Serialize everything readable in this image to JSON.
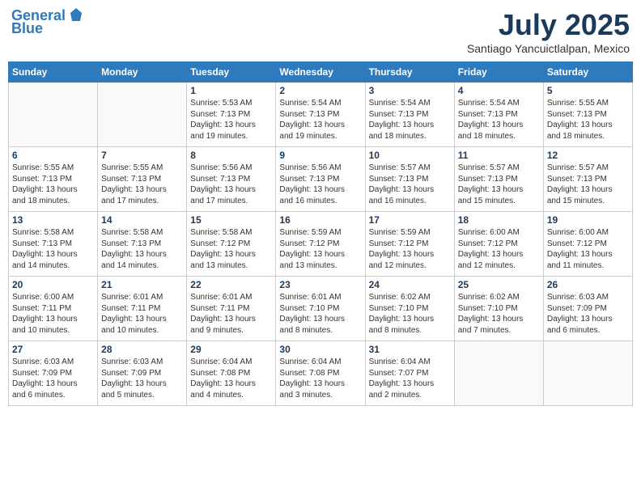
{
  "header": {
    "logo_line1": "General",
    "logo_line2": "Blue",
    "month": "July 2025",
    "location": "Santiago Yancuictlalpan, Mexico"
  },
  "days_of_week": [
    "Sunday",
    "Monday",
    "Tuesday",
    "Wednesday",
    "Thursday",
    "Friday",
    "Saturday"
  ],
  "weeks": [
    [
      {
        "day": "",
        "detail": ""
      },
      {
        "day": "",
        "detail": ""
      },
      {
        "day": "1",
        "detail": "Sunrise: 5:53 AM\nSunset: 7:13 PM\nDaylight: 13 hours\nand 19 minutes."
      },
      {
        "day": "2",
        "detail": "Sunrise: 5:54 AM\nSunset: 7:13 PM\nDaylight: 13 hours\nand 19 minutes."
      },
      {
        "day": "3",
        "detail": "Sunrise: 5:54 AM\nSunset: 7:13 PM\nDaylight: 13 hours\nand 18 minutes."
      },
      {
        "day": "4",
        "detail": "Sunrise: 5:54 AM\nSunset: 7:13 PM\nDaylight: 13 hours\nand 18 minutes."
      },
      {
        "day": "5",
        "detail": "Sunrise: 5:55 AM\nSunset: 7:13 PM\nDaylight: 13 hours\nand 18 minutes."
      }
    ],
    [
      {
        "day": "6",
        "detail": "Sunrise: 5:55 AM\nSunset: 7:13 PM\nDaylight: 13 hours\nand 18 minutes."
      },
      {
        "day": "7",
        "detail": "Sunrise: 5:55 AM\nSunset: 7:13 PM\nDaylight: 13 hours\nand 17 minutes."
      },
      {
        "day": "8",
        "detail": "Sunrise: 5:56 AM\nSunset: 7:13 PM\nDaylight: 13 hours\nand 17 minutes."
      },
      {
        "day": "9",
        "detail": "Sunrise: 5:56 AM\nSunset: 7:13 PM\nDaylight: 13 hours\nand 16 minutes."
      },
      {
        "day": "10",
        "detail": "Sunrise: 5:57 AM\nSunset: 7:13 PM\nDaylight: 13 hours\nand 16 minutes."
      },
      {
        "day": "11",
        "detail": "Sunrise: 5:57 AM\nSunset: 7:13 PM\nDaylight: 13 hours\nand 15 minutes."
      },
      {
        "day": "12",
        "detail": "Sunrise: 5:57 AM\nSunset: 7:13 PM\nDaylight: 13 hours\nand 15 minutes."
      }
    ],
    [
      {
        "day": "13",
        "detail": "Sunrise: 5:58 AM\nSunset: 7:13 PM\nDaylight: 13 hours\nand 14 minutes."
      },
      {
        "day": "14",
        "detail": "Sunrise: 5:58 AM\nSunset: 7:13 PM\nDaylight: 13 hours\nand 14 minutes."
      },
      {
        "day": "15",
        "detail": "Sunrise: 5:58 AM\nSunset: 7:12 PM\nDaylight: 13 hours\nand 13 minutes."
      },
      {
        "day": "16",
        "detail": "Sunrise: 5:59 AM\nSunset: 7:12 PM\nDaylight: 13 hours\nand 13 minutes."
      },
      {
        "day": "17",
        "detail": "Sunrise: 5:59 AM\nSunset: 7:12 PM\nDaylight: 13 hours\nand 12 minutes."
      },
      {
        "day": "18",
        "detail": "Sunrise: 6:00 AM\nSunset: 7:12 PM\nDaylight: 13 hours\nand 12 minutes."
      },
      {
        "day": "19",
        "detail": "Sunrise: 6:00 AM\nSunset: 7:12 PM\nDaylight: 13 hours\nand 11 minutes."
      }
    ],
    [
      {
        "day": "20",
        "detail": "Sunrise: 6:00 AM\nSunset: 7:11 PM\nDaylight: 13 hours\nand 10 minutes."
      },
      {
        "day": "21",
        "detail": "Sunrise: 6:01 AM\nSunset: 7:11 PM\nDaylight: 13 hours\nand 10 minutes."
      },
      {
        "day": "22",
        "detail": "Sunrise: 6:01 AM\nSunset: 7:11 PM\nDaylight: 13 hours\nand 9 minutes."
      },
      {
        "day": "23",
        "detail": "Sunrise: 6:01 AM\nSunset: 7:10 PM\nDaylight: 13 hours\nand 8 minutes."
      },
      {
        "day": "24",
        "detail": "Sunrise: 6:02 AM\nSunset: 7:10 PM\nDaylight: 13 hours\nand 8 minutes."
      },
      {
        "day": "25",
        "detail": "Sunrise: 6:02 AM\nSunset: 7:10 PM\nDaylight: 13 hours\nand 7 minutes."
      },
      {
        "day": "26",
        "detail": "Sunrise: 6:03 AM\nSunset: 7:09 PM\nDaylight: 13 hours\nand 6 minutes."
      }
    ],
    [
      {
        "day": "27",
        "detail": "Sunrise: 6:03 AM\nSunset: 7:09 PM\nDaylight: 13 hours\nand 6 minutes."
      },
      {
        "day": "28",
        "detail": "Sunrise: 6:03 AM\nSunset: 7:09 PM\nDaylight: 13 hours\nand 5 minutes."
      },
      {
        "day": "29",
        "detail": "Sunrise: 6:04 AM\nSunset: 7:08 PM\nDaylight: 13 hours\nand 4 minutes."
      },
      {
        "day": "30",
        "detail": "Sunrise: 6:04 AM\nSunset: 7:08 PM\nDaylight: 13 hours\nand 3 minutes."
      },
      {
        "day": "31",
        "detail": "Sunrise: 6:04 AM\nSunset: 7:07 PM\nDaylight: 13 hours\nand 2 minutes."
      },
      {
        "day": "",
        "detail": ""
      },
      {
        "day": "",
        "detail": ""
      }
    ]
  ]
}
